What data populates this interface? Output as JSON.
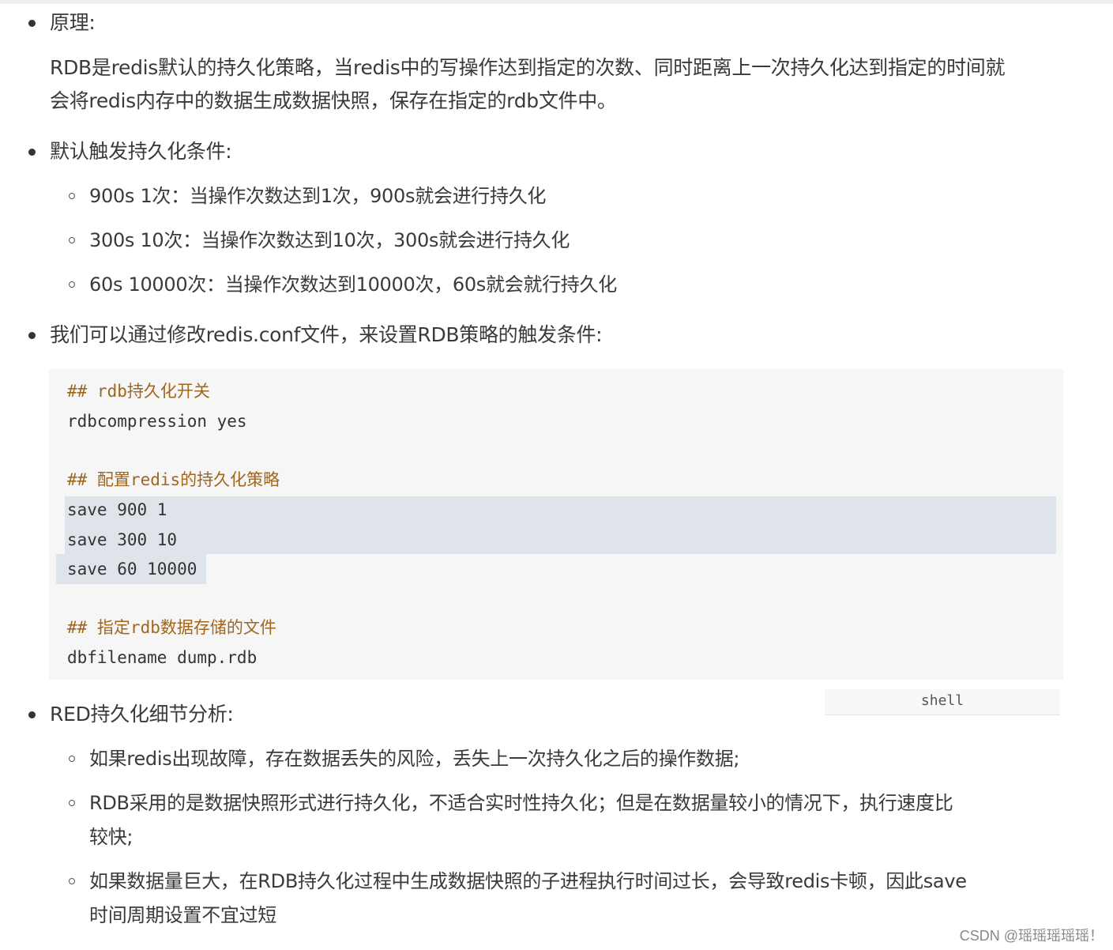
{
  "items": {
    "principle_label": "原理:",
    "principle_p1": "RDB是redis默认的持久化策略，当redis中的写操作达到指定的次数、同时距离上一次持久化达到指定的时间就",
    "principle_p2": "会将redis内存中的数据生成数据快照，保存在指定的rdb文件中。",
    "default_label": "默认触发持久化条件:",
    "default_sub": [
      "900s 1次：当操作次数达到1次，900s就会进行持久化",
      "300s 10次：当操作次数达到10次，300s就会进行持久化",
      "60s 10000次：当操作次数达到10000次，60s就会就行持久化"
    ],
    "conf_label": "我们可以通过修改redis.conf文件，来设置RDB策略的触发条件:",
    "analysis_label": "RED持久化细节分析:",
    "analysis_sub": [
      "如果redis出现故障，存在数据丢失的风险，丢失上一次持久化之后的操作数据;",
      "RDB采用的是数据快照形式进行持久化，不适合实时性持久化；但是在数据量较小的情况下，执行速度比",
      "较快;",
      "如果数据量巨大，在RDB持久化过程中生成数据快照的子进程执行时间过长，会导致redis卡顿，因此save",
      "时间周期设置不宜过短"
    ]
  },
  "code": {
    "lines": [
      "## rdb持久化开关",
      "rdbcompression yes",
      "## 配置redis的持久化策略",
      "save 900 1",
      "save 300 10",
      "save 60 10000",
      "## 指定rdb数据存储的文件",
      "dbfilename dump.rdb"
    ],
    "language": "shell"
  },
  "watermark": "CSDN @瑶瑶瑶瑶瑶！",
  "colors": {
    "comment": "#a0661f",
    "highlight": "#dfe4ea",
    "code_bg": "#f6f6f6"
  }
}
